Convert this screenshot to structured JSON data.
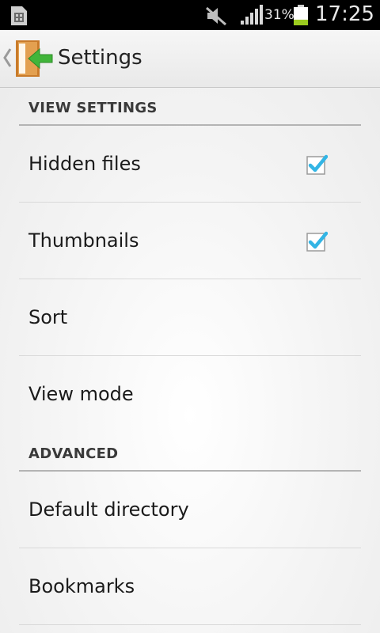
{
  "status_bar": {
    "battery_percent": "31%",
    "battery_level": 0.31,
    "time": "17:25",
    "icons": [
      "sim-card-icon",
      "mute-icon",
      "signal-icon",
      "battery-icon"
    ]
  },
  "action_bar": {
    "title": "Settings",
    "app_icon": "exit-door-arrow-icon"
  },
  "sections": [
    {
      "header": "VIEW SETTINGS",
      "items": [
        {
          "label": "Hidden files",
          "checked": true
        },
        {
          "label": "Thumbnails",
          "checked": true
        },
        {
          "label": "Sort"
        },
        {
          "label": "View mode"
        }
      ]
    },
    {
      "header": "ADVANCED",
      "items": [
        {
          "label": "Default directory"
        },
        {
          "label": "Bookmarks"
        }
      ]
    }
  ],
  "colors": {
    "checkbox_check": "#33b5e5",
    "battery_fill": "#9ccc20",
    "status_bar_bg": "#000000"
  }
}
